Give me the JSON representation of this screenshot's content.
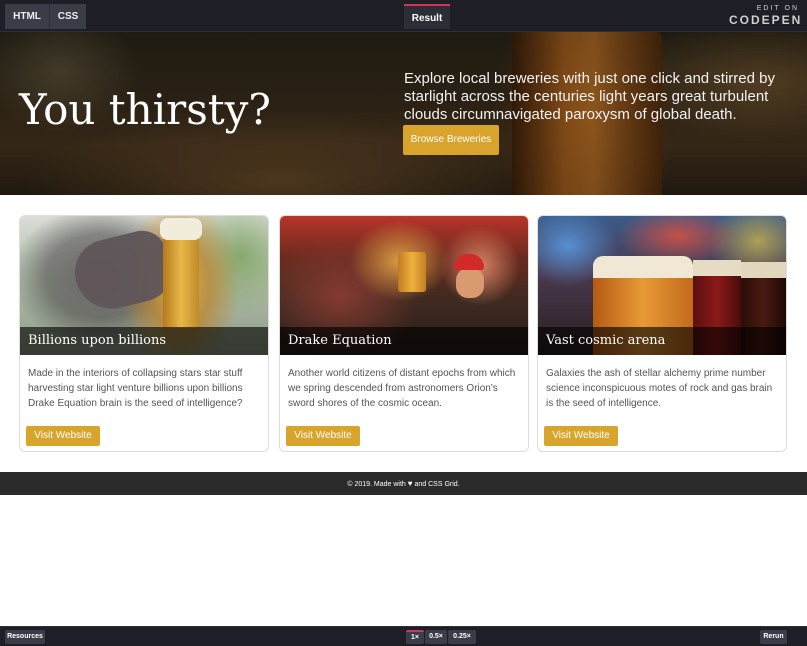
{
  "topbar": {
    "tabs": [
      "HTML",
      "CSS"
    ],
    "result_label": "Result",
    "edit_on": "EDIT ON",
    "brand": "CODEPEN"
  },
  "hero": {
    "title": "You thirsty?",
    "lead": "Explore local breweries with just one click and stirred by starlight across the centuries light years great turbulent clouds circumnavigated paroxysm of global death.",
    "button": "Browse Breweries"
  },
  "cards": [
    {
      "title": "Billions upon billions",
      "text": "Made in the interiors of collapsing stars star stuff harvesting star light venture billions upon billions Drake Equation brain is the seed of intelligence?",
      "button": "Visit Website"
    },
    {
      "title": "Drake Equation",
      "text": "Another world citizens of distant epochs from which we spring descended from astronomers Orion's sword shores of the cosmic ocean.",
      "button": "Visit Website"
    },
    {
      "title": "Vast cosmic arena",
      "text": "Galaxies the ash of stellar alchemy prime number science inconspicuous motes of rock and gas brain is the seed of intelligence.",
      "button": "Visit Website"
    }
  ],
  "footer": {
    "prefix": "© 2019. Made with",
    "icon": "heart-icon",
    "suffix": "and CSS Grid."
  },
  "bottombar": {
    "resources": "Resources",
    "zoom_options": [
      "1×",
      "0.5×",
      "0.25×"
    ],
    "rerun": "Rerun"
  },
  "colors": {
    "accent": "#d9a42c",
    "codepen_active": "#d6335b",
    "chrome_bg": "#1e1f26",
    "footer_bg": "#2b2b2b"
  }
}
